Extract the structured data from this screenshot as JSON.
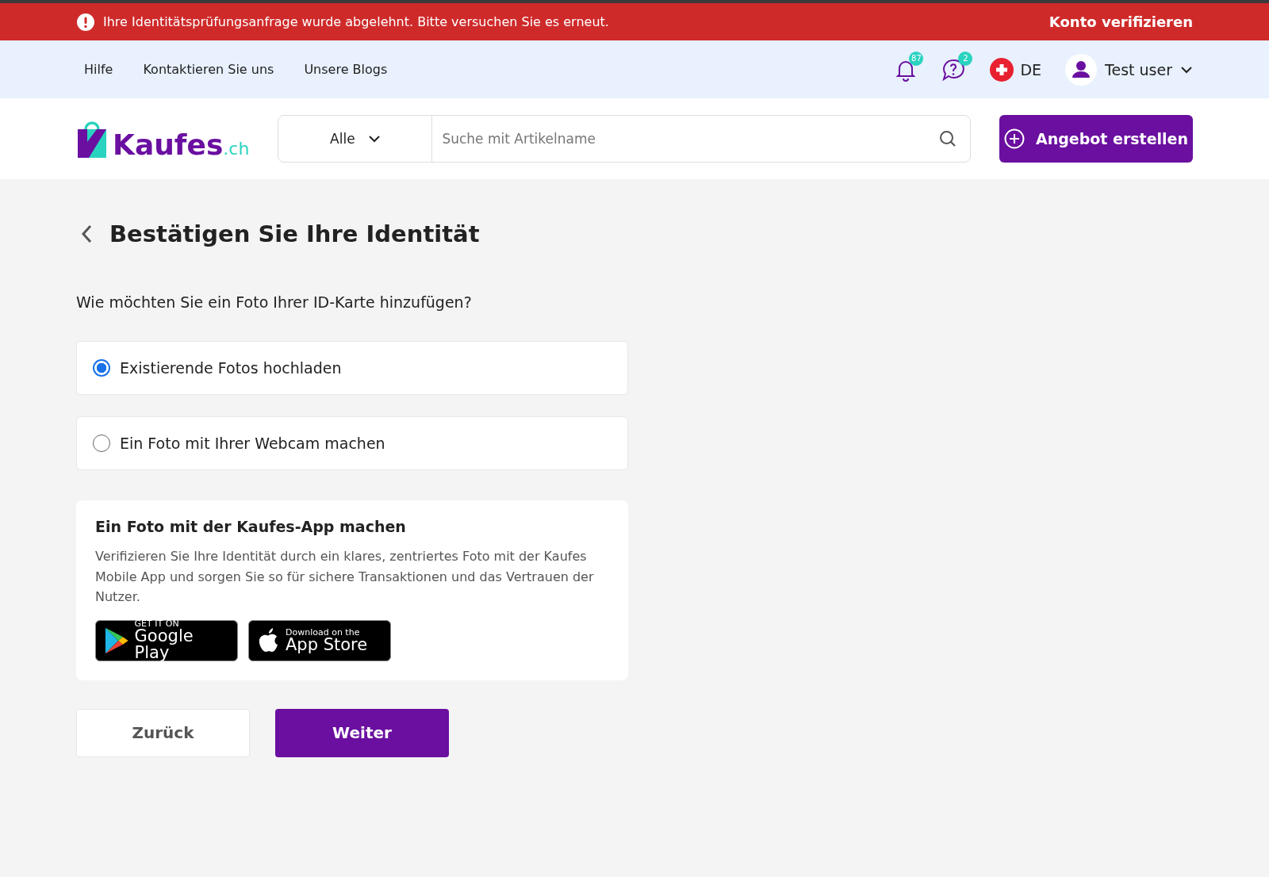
{
  "alert": {
    "message": "Ihre Identitätsprüfungsanfrage wurde abgelehnt. Bitte versuchen Sie es erneut.",
    "action": "Konto verifizieren"
  },
  "top_nav": {
    "links": [
      "Hilfe",
      "Kontaktieren Sie uns",
      "Unsere Blogs"
    ],
    "notifications_badge": "87",
    "messages_badge": "2",
    "language": "DE",
    "user": "Test user"
  },
  "header": {
    "logo": {
      "name": "Kaufes",
      "suffix": ".ch"
    },
    "category": "Alle",
    "search": {
      "placeholder": "Suche mit Artikelname"
    },
    "create_button": "Angebot erstellen"
  },
  "page": {
    "title": "Bestätigen Sie Ihre Identität",
    "question": "Wie möchten Sie ein Foto Ihrer ID-Karte hinzufügen?",
    "options": [
      {
        "label": "Existierende Fotos hochladen",
        "selected": true
      },
      {
        "label": "Ein Foto mit Ihrer Webcam machen",
        "selected": false
      }
    ],
    "app_card": {
      "title": "Ein Foto mit der Kaufes-App machen",
      "text": "Verifizieren Sie Ihre Identität durch ein klares, zentriertes Foto mit der Kaufes Mobile App und sorgen Sie so für sichere Transaktionen und das Vertrauen der Nutzer.",
      "badges": [
        {
          "kind": "google",
          "small": "GET IT ON",
          "big": "Google Play"
        },
        {
          "kind": "apple",
          "small": "Download on the",
          "big": "App Store"
        }
      ]
    },
    "back_button": "Zurück",
    "next_button": "Weiter"
  }
}
